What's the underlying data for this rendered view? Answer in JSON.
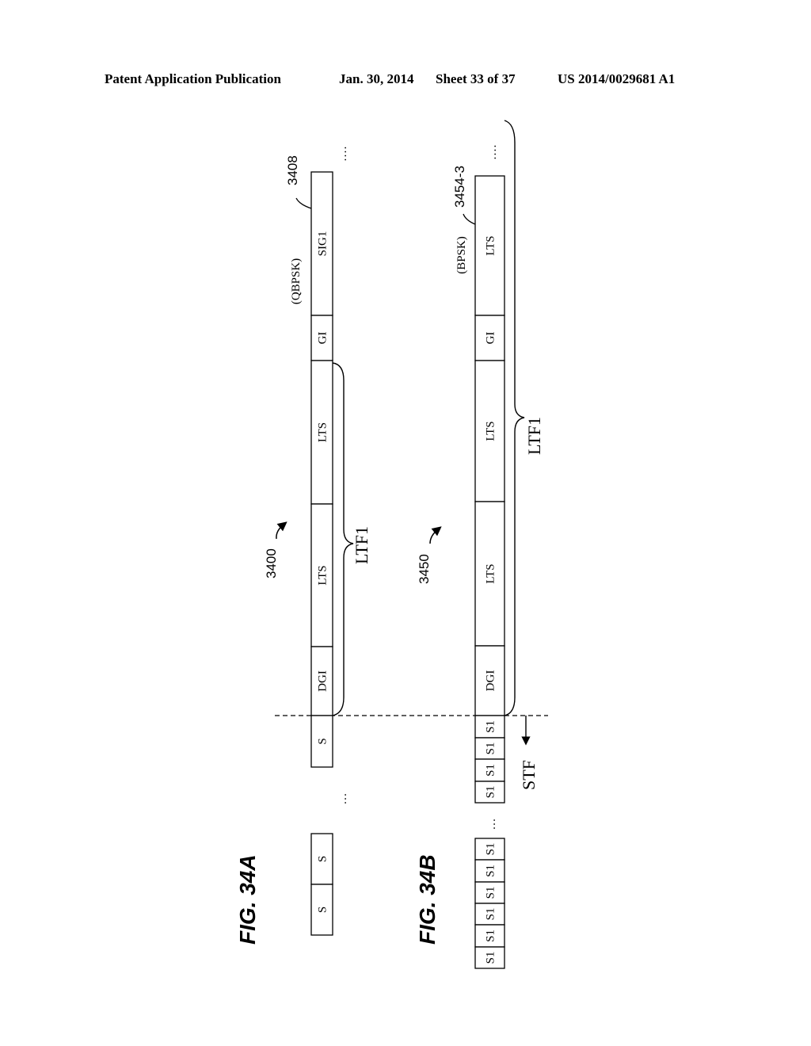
{
  "header": {
    "publication": "Patent Application Publication",
    "date": "Jan. 30, 2014",
    "sheet": "Sheet 33 of 37",
    "number": "US 2014/0029681 A1"
  },
  "fig34a": {
    "title": "FIG. 34A",
    "ref": "3400",
    "callout_ref": "3408",
    "modulation": "(QBPSK)",
    "bracket_label": "LTF1",
    "main_segments": [
      "SIG1",
      "GI",
      "LTS",
      "LTS",
      "DGI",
      "S"
    ],
    "pre_segments": [
      "S",
      "S"
    ],
    "ellipsis": "..."
  },
  "fig34b": {
    "title": "FIG. 34B",
    "ref": "3450",
    "callout_ref": "3454-3",
    "modulation": "(BPSK)",
    "bracket_label": "LTF1",
    "stf_label": "STF",
    "main_segments": [
      "LTS",
      "GI",
      "LTS",
      "LTS",
      "DGI",
      "S1",
      "S1",
      "S1",
      "S1"
    ],
    "pre_segments": [
      "S1",
      "S1",
      "S1",
      "S1",
      "S1",
      "S1"
    ],
    "ellipsis": "..."
  }
}
